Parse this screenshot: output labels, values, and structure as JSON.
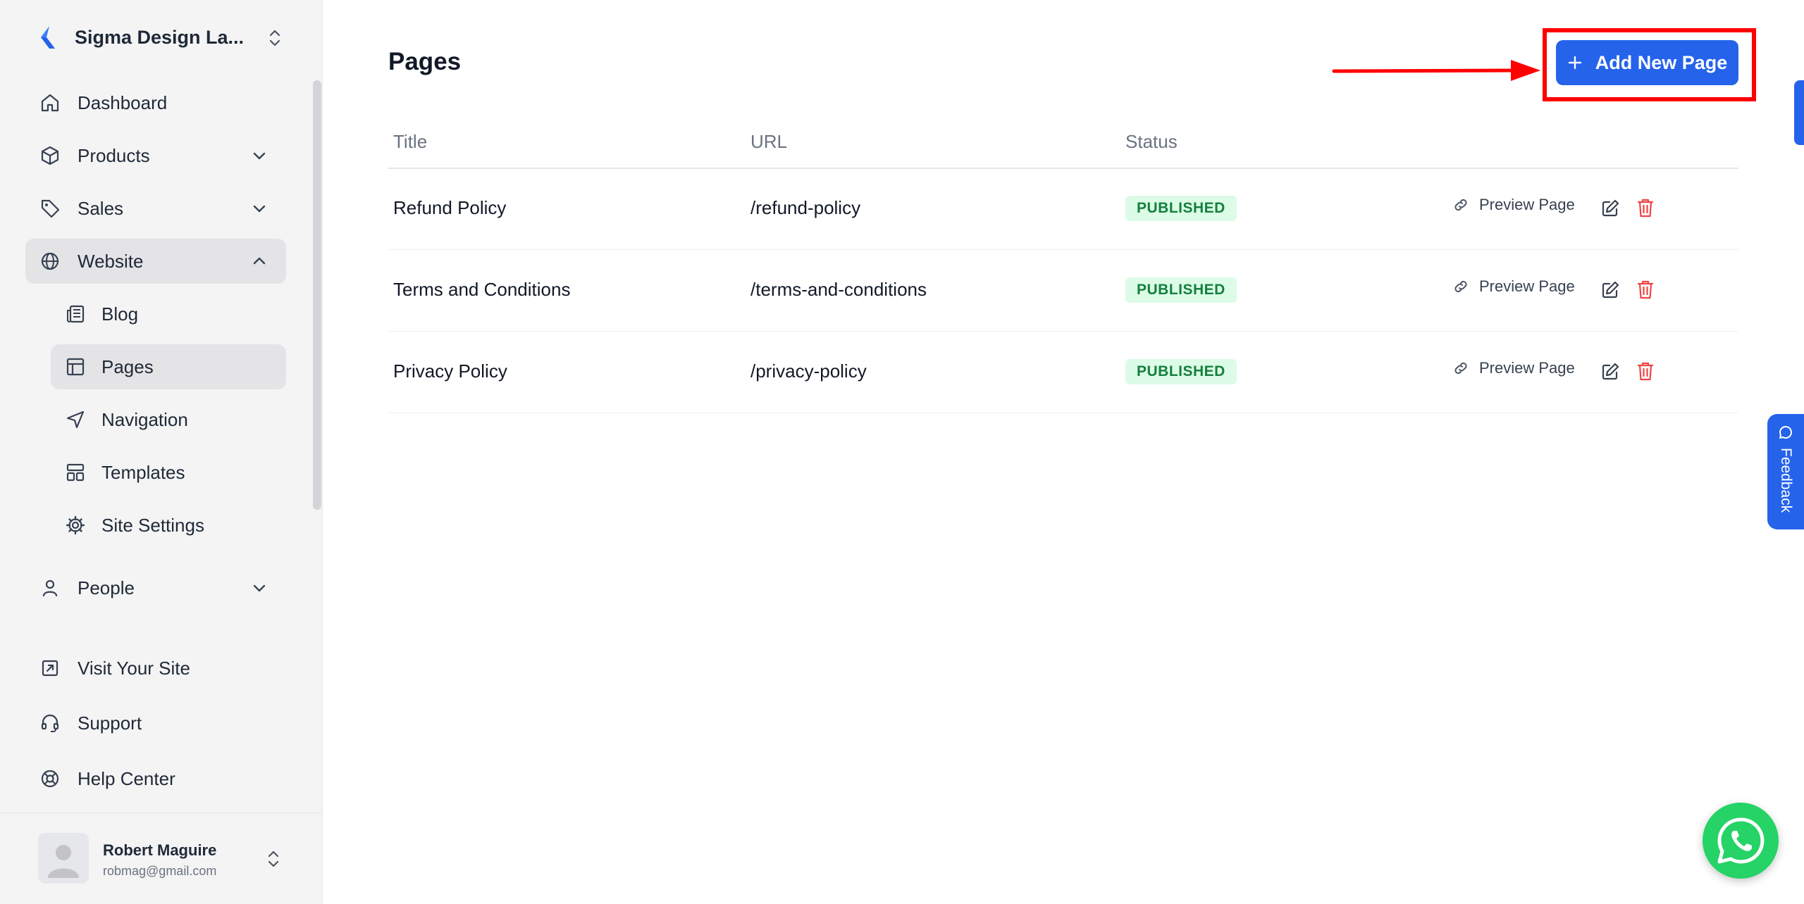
{
  "sidebar": {
    "workspace": "Sigma Design La...",
    "nav": {
      "dashboard": "Dashboard",
      "products": "Products",
      "sales": "Sales",
      "website": "Website",
      "people": "People"
    },
    "website_sub": {
      "blog": "Blog",
      "pages": "Pages",
      "navigation": "Navigation",
      "templates": "Templates",
      "site_settings": "Site Settings"
    },
    "footer_links": {
      "visit_site": "Visit Your Site",
      "support": "Support",
      "help_center": "Help Center"
    },
    "user": {
      "name": "Robert Maguire",
      "email": "robmag@gmail.com"
    }
  },
  "main": {
    "title": "Pages",
    "add_button": "Add New Page",
    "columns": {
      "title": "Title",
      "url": "URL",
      "status": "Status"
    },
    "rows": [
      {
        "title": "Refund Policy",
        "url": "/refund-policy",
        "status": "PUBLISHED",
        "preview": "Preview Page"
      },
      {
        "title": "Terms and Conditions",
        "url": "/terms-and-conditions",
        "status": "PUBLISHED",
        "preview": "Preview Page"
      },
      {
        "title": "Privacy Policy",
        "url": "/privacy-policy",
        "status": "PUBLISHED",
        "preview": "Preview Page"
      }
    ]
  },
  "feedback_label": "Feedback",
  "colors": {
    "primary": "#2563eb",
    "highlight": "#ff0000",
    "published_bg": "#dcfce7",
    "published_text": "#15803d",
    "delete": "#ef4444",
    "whatsapp": "#25d366"
  }
}
